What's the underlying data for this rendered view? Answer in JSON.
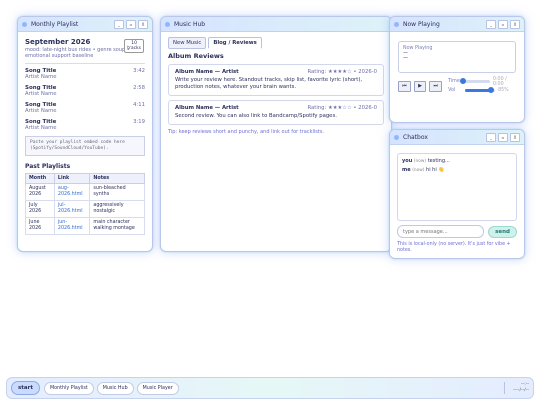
{
  "playlist": {
    "window_title": "Monthly Playlist",
    "title": "September 2026",
    "count": "10\ntracks",
    "mood": "mood: late-night bus rides • genre soup • emotional support baseline",
    "tracks": [
      {
        "title": "Song Title",
        "artist": "Artist Name",
        "length": "3:42"
      },
      {
        "title": "Song Title",
        "artist": "Artist Name",
        "length": "2:58"
      },
      {
        "title": "Song Title",
        "artist": "Artist Name",
        "length": "4:11"
      },
      {
        "title": "Song Title",
        "artist": "Artist Name",
        "length": "3:19"
      }
    ],
    "embed_placeholder": "Paste your playlist embed code here (Spotify/SoundCloud/YouTube).",
    "past_heading": "Past Playlists",
    "past_columns": [
      "Month",
      "Link",
      "Notes"
    ],
    "past_rows": [
      {
        "month": "August 2026",
        "link": "aug-2026.html",
        "notes": "sun-bleached synths"
      },
      {
        "month": "July 2026",
        "link": "jul-2026.html",
        "notes": "aggressively nostalgic"
      },
      {
        "month": "June 2026",
        "link": "jun-2026.html",
        "notes": "main character walking montage"
      }
    ]
  },
  "hub": {
    "window_title": "Music Hub",
    "tabs": [
      "New Music",
      "Blog / Reviews"
    ],
    "heading": "Album Reviews",
    "reviews": [
      {
        "album": "Album Name — Artist",
        "rating": "Rating: ★★★★☆ • 2026-0",
        "body": "Write your review here. Standout tracks, skip list, favorite lyric (short), production notes, whatever your brain wants."
      },
      {
        "album": "Album Name — Artist",
        "rating": "Rating: ★★★☆☆ • 2026-0",
        "body": "Second review. You can also link to Bandcamp/Spotify pages."
      }
    ],
    "tip": "Tip: keep reviews short and punchy, and link out for tracklists."
  },
  "nowplaying": {
    "window_title": "Now Playing",
    "label": "Now Playing",
    "track": "—",
    "sub": "—",
    "prev": "⏮",
    "play": "▶",
    "next": "⏭",
    "time_label": "Time",
    "time_value": "0:00 / 0:00",
    "time_fraction": 0,
    "vol_label": "Vol",
    "vol_value": "85%",
    "vol_fraction": 0.85
  },
  "chat": {
    "window_title": "Chatbox",
    "messages": [
      {
        "user": "you",
        "time": "(now)",
        "text": "testing..."
      },
      {
        "user": "me",
        "time": "(now)",
        "text": "hi hi 👋"
      }
    ],
    "placeholder": "type a message...",
    "send": "send",
    "note": "This is local-only (no server). It's just for vibe + notes."
  },
  "taskbar": {
    "start": "start",
    "items": [
      "Monthly Playlist",
      "Music Hub",
      "Music Player"
    ],
    "clock_time": "--:--",
    "clock_date": "----/--/--"
  },
  "window_buttons": {
    "min": "_",
    "max": "▫",
    "close": "X"
  }
}
